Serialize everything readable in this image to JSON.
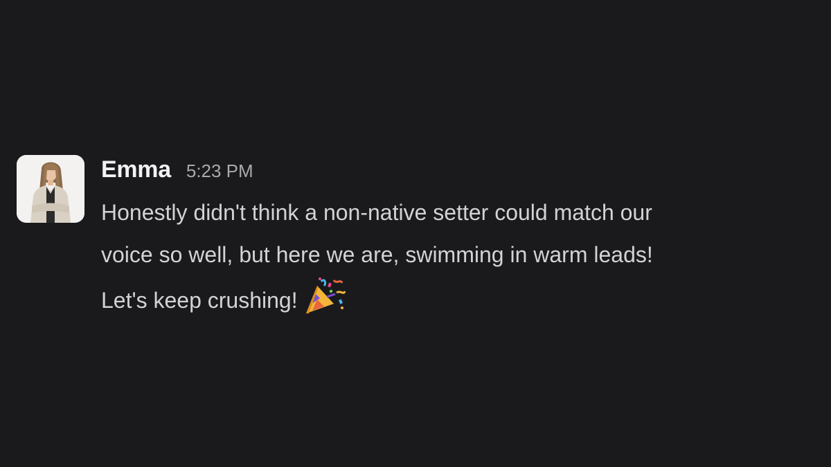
{
  "message": {
    "author": "Emma",
    "timestamp": "5:23 PM",
    "lines": [
      "Honestly didn't think a non-native setter could match our",
      "voice so well, but here we are, swimming in warm leads!",
      "Let's keep crushing!"
    ],
    "emoji": "party-popper"
  }
}
